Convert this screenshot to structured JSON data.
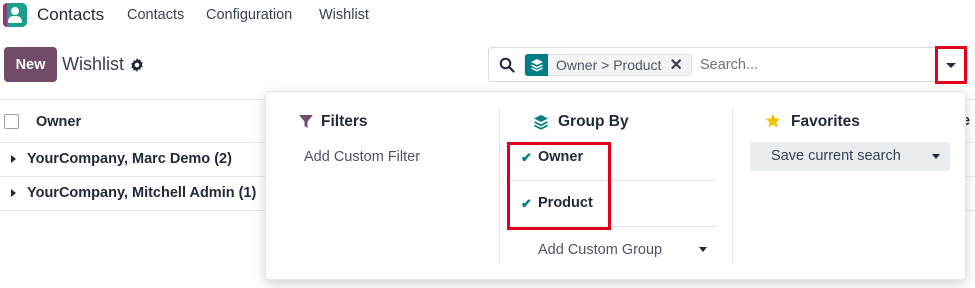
{
  "navbar": {
    "app_name": "Contacts",
    "items": [
      "Contacts",
      "Configuration",
      "Wishlist"
    ]
  },
  "control_panel": {
    "new_label": "New",
    "title": "Wishlist"
  },
  "search": {
    "facet_label": "Owner > Product",
    "facet_close": "✕",
    "placeholder": "Search..."
  },
  "list": {
    "column_owner": "Owner",
    "column_cut_off": "e",
    "groups": [
      {
        "label": "YourCompany, Marc Demo (2)"
      },
      {
        "label": "YourCompany, Mitchell Admin (1)"
      }
    ]
  },
  "dropdown": {
    "filters": {
      "title": "Filters",
      "add_custom": "Add Custom Filter"
    },
    "group_by": {
      "title": "Group By",
      "items": [
        {
          "label": "Owner",
          "checked": true
        },
        {
          "label": "Product",
          "checked": true
        }
      ],
      "add_custom": "Add Custom Group"
    },
    "favorites": {
      "title": "Favorites",
      "save_current": "Save current search"
    }
  },
  "colors": {
    "brand": "#714b67",
    "accent": "#017e84",
    "highlight": "#e0001b",
    "star": "#f3c400"
  },
  "icons": {
    "app": "contacts-app-icon",
    "gear": "gear-icon",
    "search": "search-icon",
    "facet": "layers-icon",
    "filter": "funnel-icon",
    "group_by": "layers-icon",
    "favorites": "star-icon",
    "check": "check-icon"
  }
}
